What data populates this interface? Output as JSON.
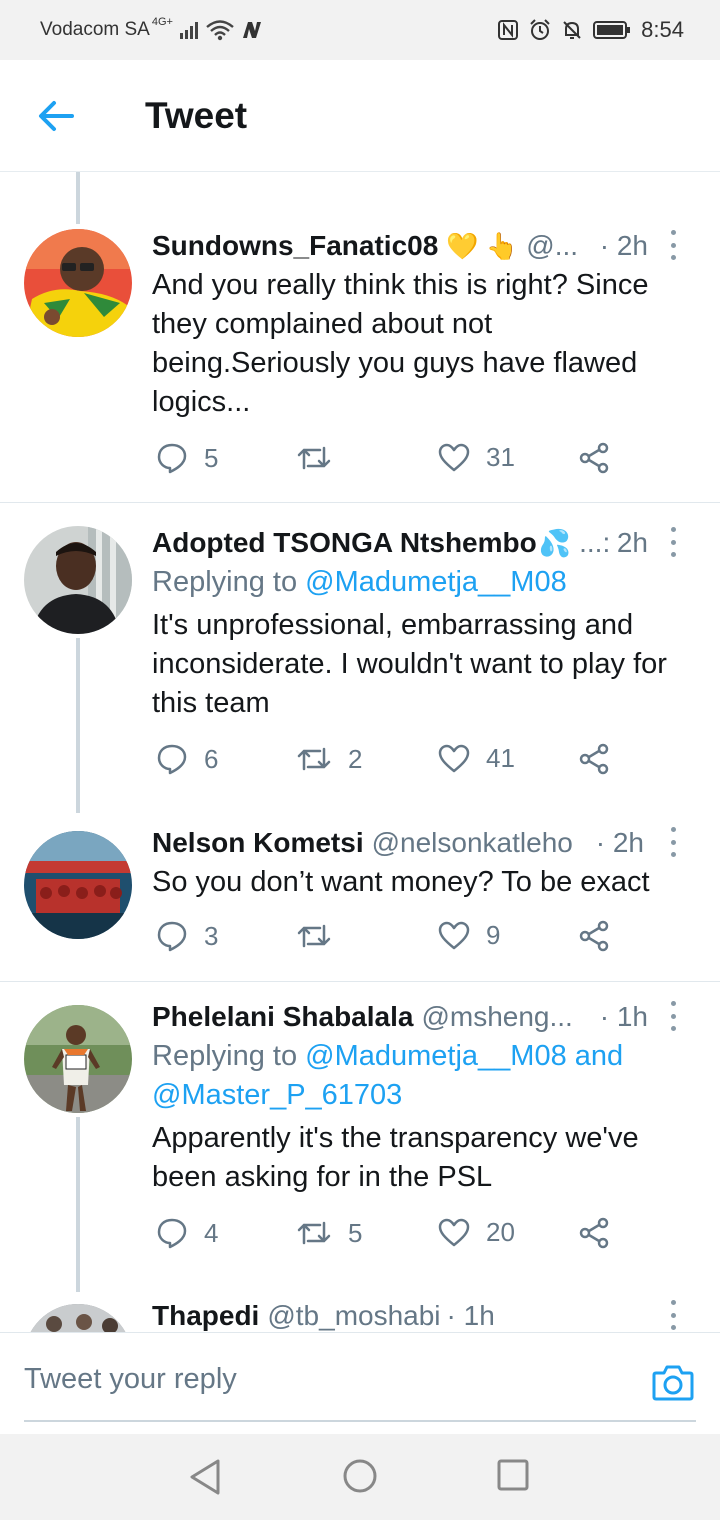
{
  "status_bar": {
    "carrier": "Vodacom SA",
    "network": "4G+",
    "time": "8:54"
  },
  "header": {
    "title": "Tweet"
  },
  "tweets": [
    {
      "name": "Sundowns_Fanatic08",
      "emoji": "💛 👆",
      "handle": "@...",
      "time": "· 2h",
      "replying_prefix": "",
      "replying_to": "",
      "text": "And you really think this is right? Since they complained about not being.Seriously you guys have flawed logics...",
      "replies": "5",
      "retweets": "",
      "likes": "31"
    },
    {
      "name": "Adopted TSONGA Ntshembo",
      "emoji": "💦",
      "handle": "...:",
      "time": "2h",
      "replying_prefix": "Replying to",
      "replying_to": "@Madumetja__M08",
      "text": "It's unprofessional, embarrassing and inconsiderate. I wouldn't want to play for this team",
      "replies": "6",
      "retweets": "2",
      "likes": "41"
    },
    {
      "name": "Nelson Kometsi",
      "emoji": "",
      "handle": "@nelsonkatleho",
      "time": "· 2h",
      "replying_prefix": "",
      "replying_to": "",
      "text": "So you don’t want money? To be exact",
      "replies": "3",
      "retweets": "",
      "likes": "9"
    },
    {
      "name": "Phelelani Shabalala",
      "emoji": "",
      "handle": "@msheng...",
      "time": "· 1h",
      "replying_prefix": "Replying to",
      "replying_to": "@Madumetja__M08 and @Master_P_61703",
      "text": "Apparently it's the transparency we've been asking for in the PSL",
      "replies": "4",
      "retweets": "5",
      "likes": "20"
    },
    {
      "name": "Thapedi",
      "emoji": "",
      "handle": "@tb_moshabi",
      "time": "· 1h"
    }
  ],
  "reply_bar": {
    "placeholder": "Tweet your reply"
  },
  "colors": {
    "accent": "#1da1f2",
    "secondary_text": "#657786",
    "primary_text": "#14171a"
  }
}
